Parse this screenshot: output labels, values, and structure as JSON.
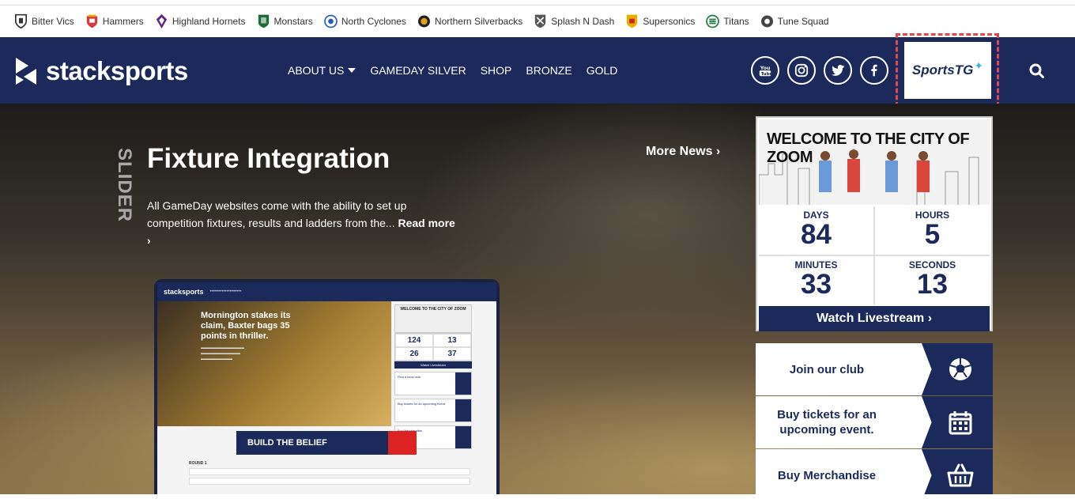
{
  "teams": [
    {
      "name": "Bitter Vics",
      "icon": "bitter-vics-crest-icon",
      "color": "#333333"
    },
    {
      "name": "Hammers",
      "icon": "hammers-crest-icon",
      "color": "#d63b3b"
    },
    {
      "name": "Highland Hornets",
      "icon": "highland-hornets-crest-icon",
      "color": "#5b2a86"
    },
    {
      "name": "Monstars",
      "icon": "monstars-crest-icon",
      "color": "#1e6b3a"
    },
    {
      "name": "North Cyclones",
      "icon": "north-cyclones-crest-icon",
      "color": "#2a5bb5"
    },
    {
      "name": "Northern Silverbacks",
      "icon": "northern-silverbacks-crest-icon",
      "color": "#e0a31c"
    },
    {
      "name": "Splash N Dash",
      "icon": "splash-n-dash-crest-icon",
      "color": "#555555"
    },
    {
      "name": "Supersonics",
      "icon": "supersonics-crest-icon",
      "color": "#e5b100"
    },
    {
      "name": "Titans",
      "icon": "titans-crest-icon",
      "color": "#1f7a3f"
    },
    {
      "name": "Tune Squad",
      "icon": "tune-squad-crest-icon",
      "color": "#444444"
    }
  ],
  "header": {
    "logo_text": "stacksports",
    "menu": [
      {
        "label": "ABOUT US",
        "has_dropdown": true
      },
      {
        "label": "GAMEDAY SILVER",
        "has_dropdown": false
      },
      {
        "label": "SHOP",
        "has_dropdown": false
      },
      {
        "label": "BRONZE",
        "has_dropdown": false
      },
      {
        "label": "GOLD",
        "has_dropdown": false
      }
    ],
    "socials": [
      "youtube-icon",
      "instagram-icon",
      "twitter-icon",
      "facebook-icon"
    ],
    "sponsor_logo": "SportsTG",
    "search_icon": "search-icon"
  },
  "hero": {
    "slider_label": "SLIDER",
    "title": "Fixture Integration",
    "description": "All GameDay websites come with the ability to set up competition fixtures, results and ladders from the...",
    "read_more": "Read more",
    "more_news": "More News",
    "mockup": {
      "logo": "stacksports",
      "headline": "Mornington stakes its claim, Baxter bags 35 points in thriller.",
      "poster": "WELCOME TO THE CITY OF ZOOM",
      "counts": [
        "124",
        "13",
        "26",
        "37"
      ],
      "livestream": "Watch Livestream",
      "banner": "BUILD THE BELIEF",
      "round": "ROUND 1",
      "actions": [
        "Find a local club.",
        "Buy tickets for an upcoming event.",
        "Buy Merchandise."
      ]
    }
  },
  "countdown": {
    "poster_title": "WELCOME TO THE CITY OF ZOOM",
    "days_label": "DAYS",
    "days": "84",
    "hours_label": "HOURS",
    "hours": "5",
    "minutes_label": "MINUTES",
    "minutes": "33",
    "seconds_label": "SECONDS",
    "seconds": "13",
    "livestream": "Watch Livestream"
  },
  "actions": [
    {
      "label": "Join our club",
      "icon": "soccer-ball-icon"
    },
    {
      "label": "Buy tickets for an upcoming event.",
      "icon": "calendar-icon"
    },
    {
      "label": "Buy Merchandise",
      "icon": "shopping-basket-icon"
    }
  ],
  "colors": {
    "navy": "#1b2a5b",
    "accent_dashed": "#e0484e",
    "sportstg_star": "#3ab6e0"
  }
}
